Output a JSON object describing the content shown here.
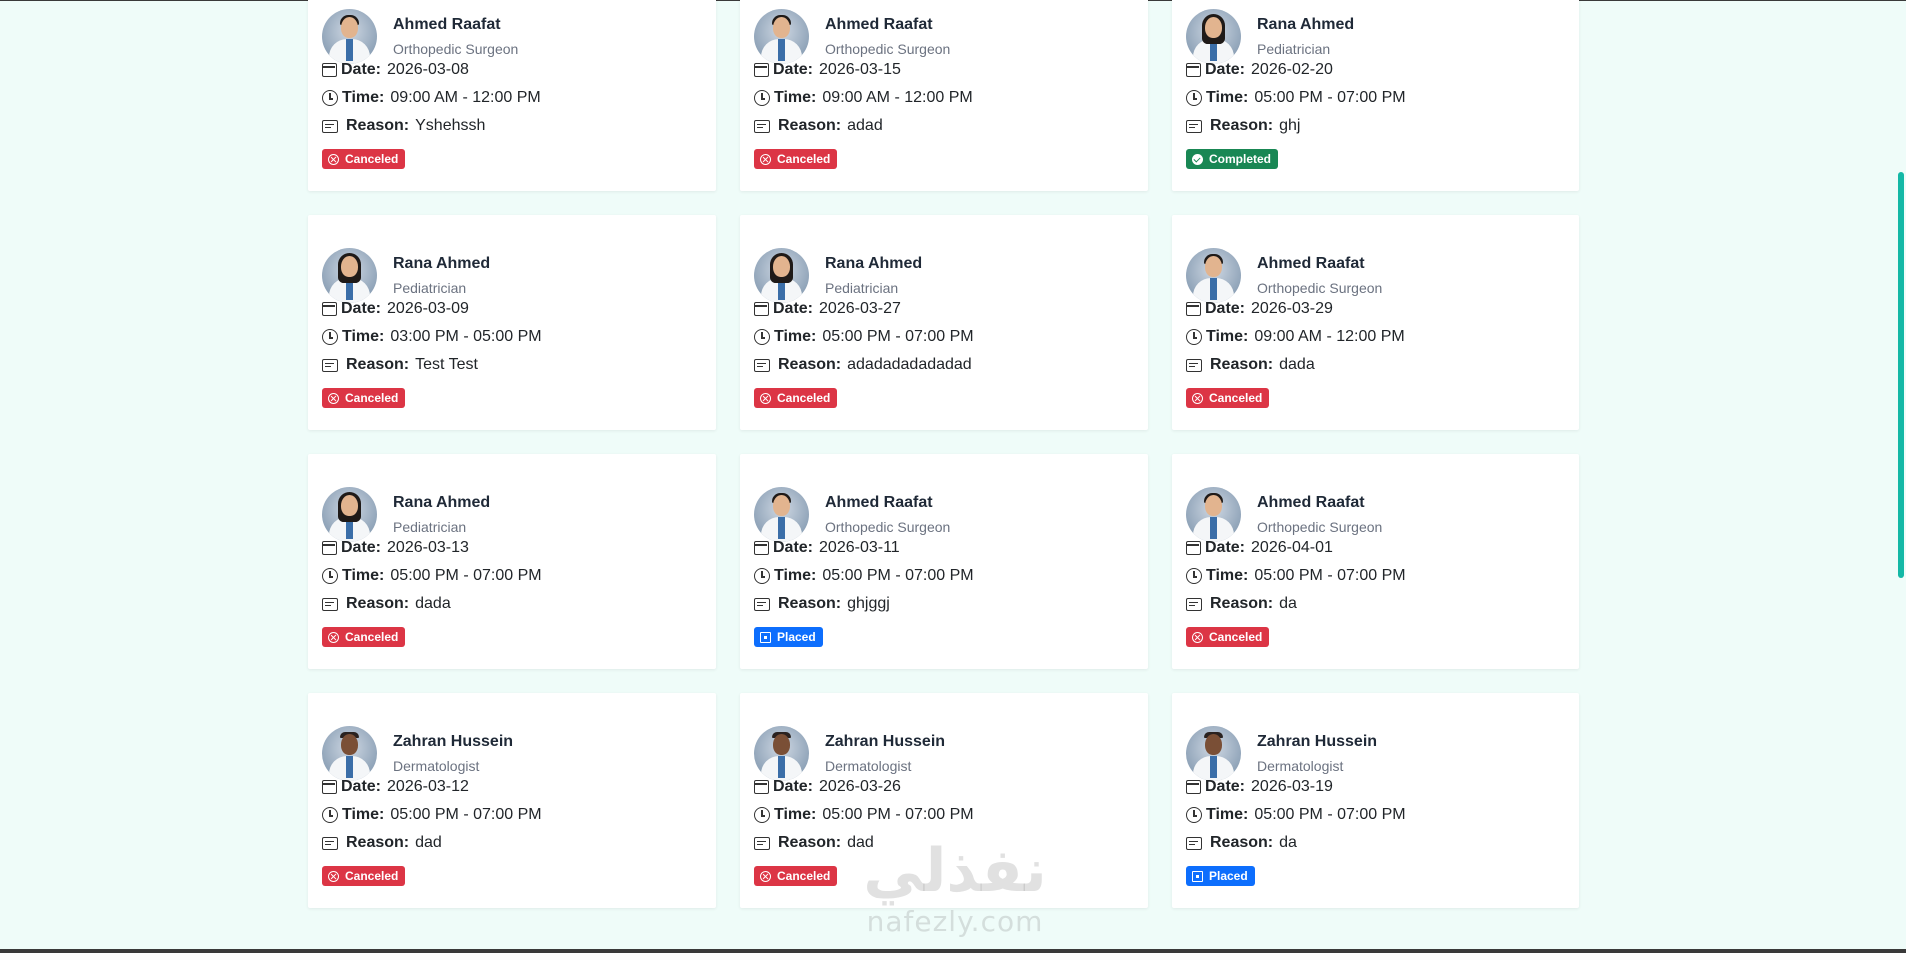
{
  "labels": {
    "date": "Date:",
    "time": "Time:",
    "reason": "Reason:"
  },
  "status_colors": {
    "Canceled": "#dc3545",
    "Completed": "#198754",
    "Placed": "#0d6efd"
  },
  "appointments": [
    {
      "doctor": "Ahmed Raafat",
      "specialty": "Orthopedic Surgeon",
      "date": "2026-03-08",
      "time": "09:00 AM - 12:00 PM",
      "reason": "Yshehssh",
      "status": "Canceled"
    },
    {
      "doctor": "Ahmed Raafat",
      "specialty": "Orthopedic Surgeon",
      "date": "2026-03-15",
      "time": "09:00 AM - 12:00 PM",
      "reason": "adad",
      "status": "Canceled"
    },
    {
      "doctor": "Rana Ahmed",
      "specialty": "Pediatrician",
      "date": "2026-02-20",
      "time": "05:00 PM - 07:00 PM",
      "reason": "ghj",
      "status": "Completed"
    },
    {
      "doctor": "Rana Ahmed",
      "specialty": "Pediatrician",
      "date": "2026-03-09",
      "time": "03:00 PM - 05:00 PM",
      "reason": "Test Test",
      "status": "Canceled"
    },
    {
      "doctor": "Rana Ahmed",
      "specialty": "Pediatrician",
      "date": "2026-03-27",
      "time": "05:00 PM - 07:00 PM",
      "reason": "adadadadadadad",
      "status": "Canceled"
    },
    {
      "doctor": "Ahmed Raafat",
      "specialty": "Orthopedic Surgeon",
      "date": "2026-03-29",
      "time": "09:00 AM - 12:00 PM",
      "reason": "dada",
      "status": "Canceled"
    },
    {
      "doctor": "Rana Ahmed",
      "specialty": "Pediatrician",
      "date": "2026-03-13",
      "time": "05:00 PM - 07:00 PM",
      "reason": "dada",
      "status": "Canceled"
    },
    {
      "doctor": "Ahmed Raafat",
      "specialty": "Orthopedic Surgeon",
      "date": "2026-03-11",
      "time": "05:00 PM - 07:00 PM",
      "reason": "ghjggj",
      "status": "Placed"
    },
    {
      "doctor": "Ahmed Raafat",
      "specialty": "Orthopedic Surgeon",
      "date": "2026-04-01",
      "time": "05:00 PM - 07:00 PM",
      "reason": "da",
      "status": "Canceled"
    },
    {
      "doctor": "Zahran Hussein",
      "specialty": "Dermatologist",
      "date": "2026-03-12",
      "time": "05:00 PM - 07:00 PM",
      "reason": "dad",
      "status": "Canceled"
    },
    {
      "doctor": "Zahran Hussein",
      "specialty": "Dermatologist",
      "date": "2026-03-26",
      "time": "05:00 PM - 07:00 PM",
      "reason": "dad",
      "status": "Canceled"
    },
    {
      "doctor": "Zahran Hussein",
      "specialty": "Dermatologist",
      "date": "2026-03-19",
      "time": "05:00 PM - 07:00 PM",
      "reason": "da",
      "status": "Placed"
    }
  ],
  "watermark": {
    "arabic": "نفذلي",
    "latin": "nafezly.com"
  }
}
